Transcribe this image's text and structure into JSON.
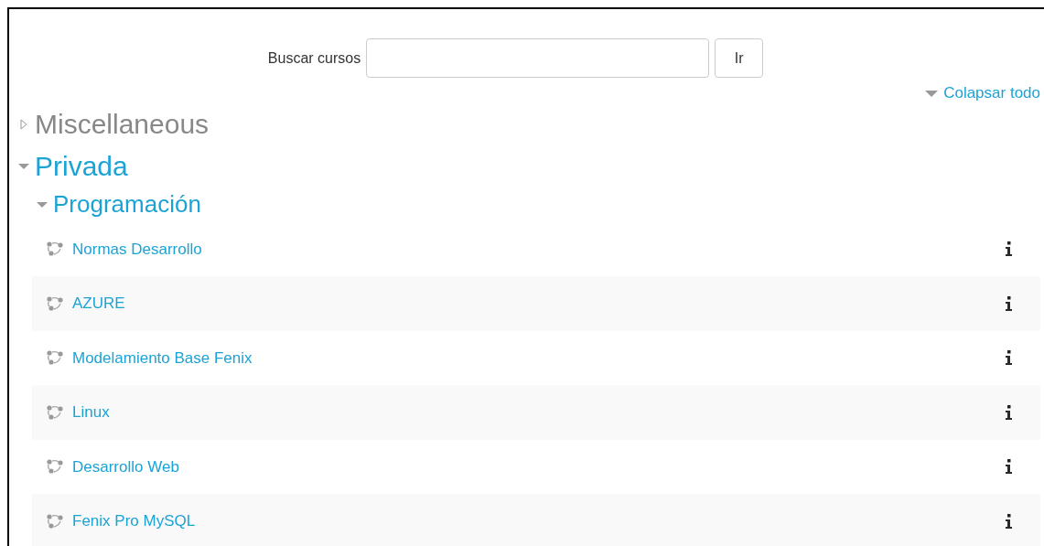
{
  "search": {
    "label": "Buscar cursos",
    "button": "Ir"
  },
  "collapse_all": "Colapsar todo",
  "categories": [
    {
      "name": "Miscellaneous",
      "expanded": false
    },
    {
      "name": "Privada",
      "expanded": true,
      "children": [
        {
          "name": "Programación",
          "expanded": true,
          "courses": [
            {
              "name": "Normas Desarrollo"
            },
            {
              "name": "AZURE"
            },
            {
              "name": "Modelamiento Base Fenix"
            },
            {
              "name": "Linux"
            },
            {
              "name": "Desarrollo Web"
            },
            {
              "name": "Fenix Pro MySQL"
            }
          ]
        }
      ]
    }
  ]
}
